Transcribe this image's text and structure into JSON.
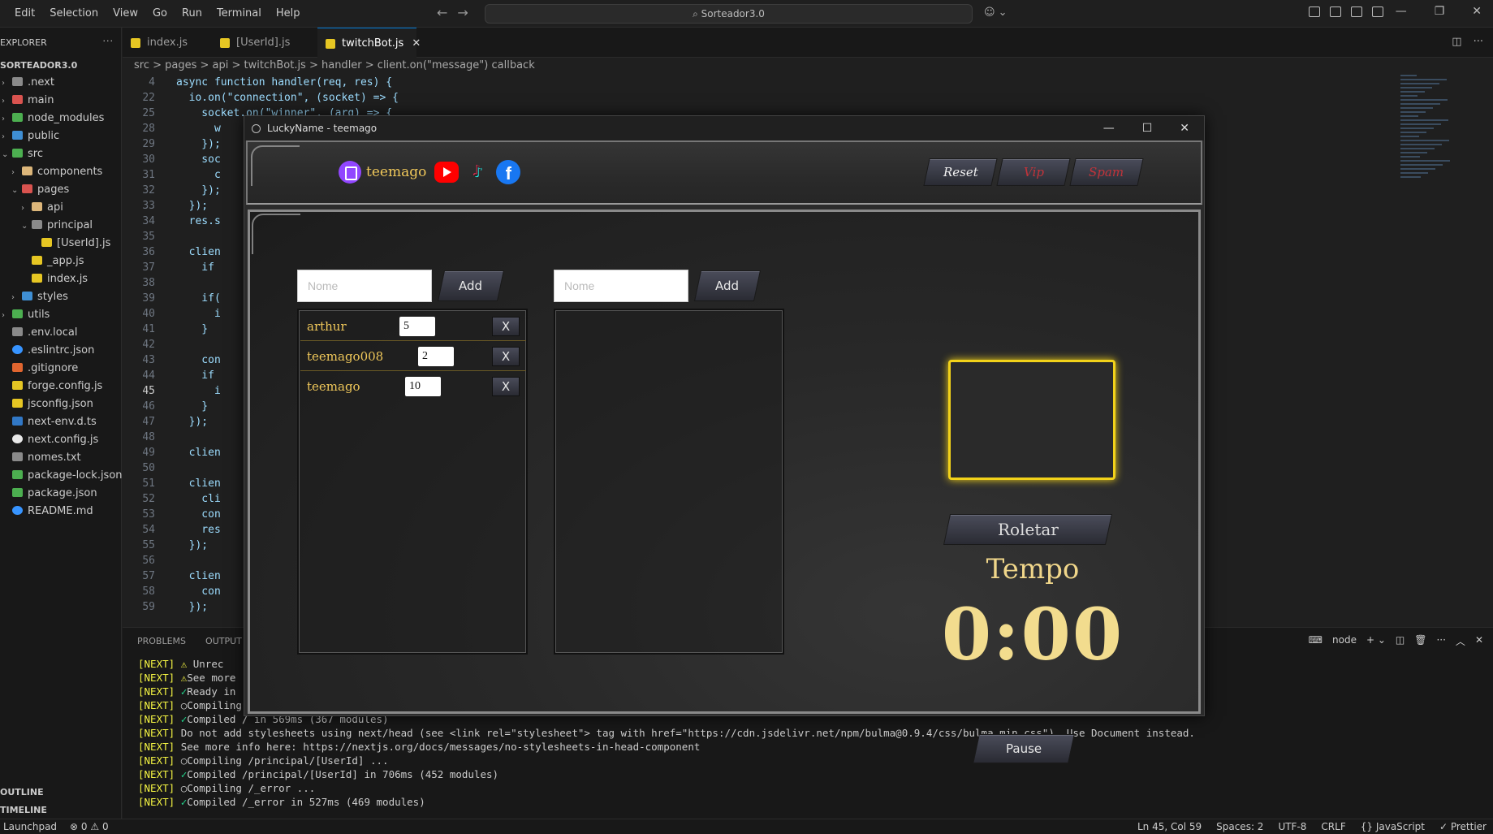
{
  "vscode": {
    "menu": [
      "Edit",
      "Selection",
      "View",
      "Go",
      "Run",
      "Terminal",
      "Help"
    ],
    "search": "Sorteador3.0",
    "explorer_title": "EXPLORER",
    "project": "SORTEADOR3.0",
    "tree": [
      {
        "label": ".next",
        "indent": 0,
        "chev": ">",
        "icon": "ic-grey"
      },
      {
        "label": "main",
        "indent": 0,
        "chev": ">",
        "icon": "ic-red"
      },
      {
        "label": "node_modules",
        "indent": 0,
        "chev": ">",
        "icon": "ic-green"
      },
      {
        "label": "public",
        "indent": 0,
        "chev": ">",
        "icon": "ic-blue"
      },
      {
        "label": "src",
        "indent": 0,
        "chev": "v",
        "icon": "ic-green"
      },
      {
        "label": "components",
        "indent": 1,
        "chev": ">",
        "icon": "ic-folder"
      },
      {
        "label": "pages",
        "indent": 1,
        "chev": "v",
        "icon": "ic-red"
      },
      {
        "label": "api",
        "indent": 2,
        "chev": ">",
        "icon": "ic-folder"
      },
      {
        "label": "principal",
        "indent": 2,
        "chev": "v",
        "icon": "ic-grey"
      },
      {
        "label": "[UserId].js",
        "indent": 3,
        "chev": "",
        "icon": "ic-js"
      },
      {
        "label": "_app.js",
        "indent": 2,
        "chev": "",
        "icon": "ic-js"
      },
      {
        "label": "index.js",
        "indent": 2,
        "chev": "",
        "icon": "ic-js"
      },
      {
        "label": "styles",
        "indent": 1,
        "chev": ">",
        "icon": "ic-blue"
      },
      {
        "label": "utils",
        "indent": 0,
        "chev": ">",
        "icon": "ic-green"
      },
      {
        "label": ".env.local",
        "indent": 0,
        "chev": "",
        "icon": "ic-grey"
      },
      {
        "label": ".eslintrc.json",
        "indent": 0,
        "chev": "",
        "icon": "ic-circle-blue"
      },
      {
        "label": ".gitignore",
        "indent": 0,
        "chev": "",
        "icon": "ic-orange"
      },
      {
        "label": "forge.config.js",
        "indent": 0,
        "chev": "",
        "icon": "ic-js"
      },
      {
        "label": "jsconfig.json",
        "indent": 0,
        "chev": "",
        "icon": "ic-js"
      },
      {
        "label": "next-env.d.ts",
        "indent": 0,
        "chev": "",
        "icon": "ic-ts"
      },
      {
        "label": "next.config.js",
        "indent": 0,
        "chev": "",
        "icon": "ic-white"
      },
      {
        "label": "nomes.txt",
        "indent": 0,
        "chev": "",
        "icon": "ic-grey"
      },
      {
        "label": "package-lock.json",
        "indent": 0,
        "chev": "",
        "icon": "ic-green"
      },
      {
        "label": "package.json",
        "indent": 0,
        "chev": "",
        "icon": "ic-green"
      },
      {
        "label": "README.md",
        "indent": 0,
        "chev": "",
        "icon": "ic-circle-blue"
      }
    ],
    "outline": "OUTLINE",
    "timeline": "TIMELINE",
    "tabs": [
      {
        "label": "index.js",
        "active": false
      },
      {
        "label": "[UserId].js",
        "active": false
      },
      {
        "label": "twitchBot.js",
        "active": true
      }
    ],
    "breadcrumb": "src > pages > api > twitchBot.js > handler > client.on(\"message\") callback",
    "code_lines": [
      {
        "n": "4",
        "text": "async function handler(req, res) {"
      },
      {
        "n": "22",
        "text": "  io.on(\"connection\", (socket) => {"
      },
      {
        "n": "25",
        "text": "    socket.on(\"winner\", (arg) => {"
      },
      {
        "n": "28",
        "text": "      w"
      },
      {
        "n": "29",
        "text": "    });"
      },
      {
        "n": "30",
        "text": "    soc"
      },
      {
        "n": "31",
        "text": "      c"
      },
      {
        "n": "32",
        "text": "    });"
      },
      {
        "n": "33",
        "text": "  });"
      },
      {
        "n": "34",
        "text": "  res.s"
      },
      {
        "n": "35",
        "text": ""
      },
      {
        "n": "36",
        "text": "  clien"
      },
      {
        "n": "37",
        "text": "    if"
      },
      {
        "n": "38",
        "text": ""
      },
      {
        "n": "39",
        "text": "    if("
      },
      {
        "n": "40",
        "text": "      i"
      },
      {
        "n": "41",
        "text": "    }"
      },
      {
        "n": "42",
        "text": ""
      },
      {
        "n": "43",
        "text": "    con"
      },
      {
        "n": "44",
        "text": "    if"
      },
      {
        "n": "45",
        "text": "      i"
      },
      {
        "n": "46",
        "text": "    }"
      },
      {
        "n": "47",
        "text": "  });"
      },
      {
        "n": "48",
        "text": ""
      },
      {
        "n": "49",
        "text": "  clien"
      },
      {
        "n": "50",
        "text": ""
      },
      {
        "n": "51",
        "text": "  clien"
      },
      {
        "n": "52",
        "text": "    cli"
      },
      {
        "n": "53",
        "text": "    con"
      },
      {
        "n": "54",
        "text": "    res"
      },
      {
        "n": "55",
        "text": "  });"
      },
      {
        "n": "56",
        "text": ""
      },
      {
        "n": "57",
        "text": "  clien"
      },
      {
        "n": "58",
        "text": "    con"
      },
      {
        "n": "59",
        "text": "  });"
      }
    ],
    "panel_tabs": [
      "PROBLEMS",
      "OUTPUT"
    ],
    "panel_right": "node",
    "terminal": [
      {
        "p": "[NEXT]",
        "mark": "⚠",
        "cls": "warn",
        "text": " Unrec"
      },
      {
        "p": "[NEXT]",
        "mark": "⚠",
        "cls": "warn",
        "text": "See more"
      },
      {
        "p": "[NEXT]",
        "mark": "✓",
        "cls": "chk",
        "text": "Ready in"
      },
      {
        "p": "[NEXT]",
        "mark": "○",
        "cls": "",
        "text": "Compiling"
      },
      {
        "p": "[NEXT]",
        "mark": "✓",
        "cls": "chk",
        "text": "Compiled / in 569ms (367 modules)"
      },
      {
        "p": "[NEXT]",
        "mark": "",
        "cls": "",
        "text": "Do not add stylesheets using next/head (see <link rel=\"stylesheet\"> tag with href=\"https://cdn.jsdelivr.net/npm/bulma@0.9.4/css/bulma.min.css\"). Use Document instead."
      },
      {
        "p": "[NEXT]",
        "mark": "",
        "cls": "",
        "text": "See more info here: https://nextjs.org/docs/messages/no-stylesheets-in-head-component"
      },
      {
        "p": "[NEXT]",
        "mark": "○",
        "cls": "",
        "text": "Compiling /principal/[UserId] ..."
      },
      {
        "p": "[NEXT]",
        "mark": "✓",
        "cls": "chk",
        "text": "Compiled /principal/[UserId] in 706ms (452 modules)"
      },
      {
        "p": "[NEXT]",
        "mark": "○",
        "cls": "",
        "text": "Compiling /_error ..."
      },
      {
        "p": "[NEXT]",
        "mark": "✓",
        "cls": "chk",
        "text": "Compiled /_error in 527ms (469 modules)"
      }
    ],
    "status_left": [
      "Launchpad",
      "⊗ 0 ⚠ 0"
    ],
    "status_right": [
      "Ln 45, Col 59",
      "Spaces: 2",
      "UTF-8",
      "CRLF",
      "{} JavaScript",
      "✓ Prettier"
    ]
  },
  "app": {
    "title": "LuckyName - teemago",
    "channel": "teemago",
    "header_buttons": {
      "reset": "Reset",
      "vip": "Vip",
      "spam": "Spam"
    },
    "left_input_placeholder": "Nome",
    "right_input_placeholder": "Nome",
    "add_label": "Add",
    "entries": [
      {
        "name": "arthur",
        "value": "5",
        "remove": "X"
      },
      {
        "name": "teemago008",
        "value": "2",
        "remove": "X"
      },
      {
        "name": "teemago",
        "value": "10",
        "remove": "X"
      }
    ],
    "roll_label": "Roletar",
    "tempo_label": "Tempo",
    "timer": "0:00",
    "pause_label": "Pause",
    "accent_gold": "#f0c85a",
    "highlight_yellow": "#f2d21a"
  }
}
